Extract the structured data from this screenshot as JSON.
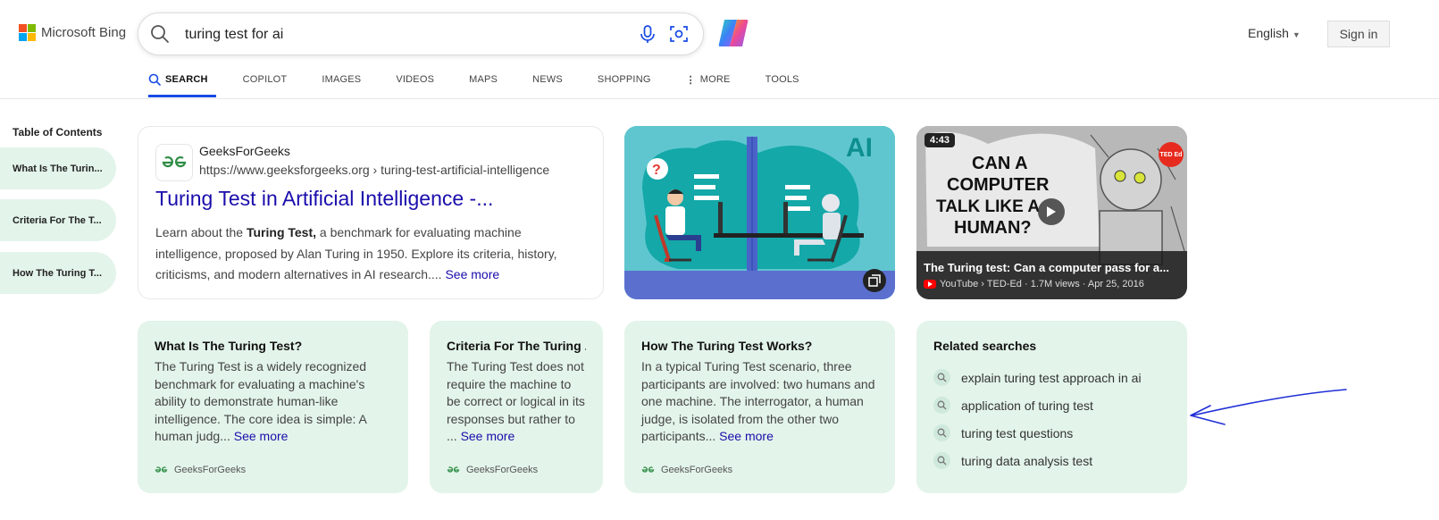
{
  "header": {
    "logo_text": "Microsoft Bing",
    "search_query": "turing test for ai",
    "language": "English",
    "sign_in": "Sign in"
  },
  "nav": {
    "tabs": [
      "SEARCH",
      "COPILOT",
      "IMAGES",
      "VIDEOS",
      "MAPS",
      "NEWS",
      "SHOPPING",
      "MORE",
      "TOOLS"
    ],
    "active": "SEARCH"
  },
  "toc": {
    "title": "Table of Contents",
    "items": [
      "What Is The Turin...",
      "Criteria For The T...",
      "How The Turing T..."
    ]
  },
  "result": {
    "site_name": "GeeksForGeeks",
    "url": "https://www.geeksforgeeks.org › turing-test-artificial-intelligence",
    "title": "Turing Test in Artificial Intelligence -...",
    "snippet_before": "Learn about the ",
    "snippet_bold": "Turing Test,",
    "snippet_after": " a benchmark for evaluating machine intelligence, proposed by Alan Turing in 1950. Explore its criteria, history, criticisms, and modern alternatives in AI research.... ",
    "see_more": "See more"
  },
  "image_tile": {
    "badge": "AI"
  },
  "video": {
    "duration": "4:43",
    "overlay_text": [
      "CAN A",
      "COMPUTER",
      "TALK LIKE A",
      "HUMAN?"
    ],
    "channel_badge": "TED Ed",
    "title": "The Turing test: Can a computer pass for a...",
    "meta": "YouTube › TED-Ed · 1.7M views · Apr 25, 2016"
  },
  "cards": [
    {
      "title": "What Is The Turing Test?",
      "body": "The Turing Test is a widely recognized benchmark for evaluating a machine's ability to demonstrate human-like intelligence. The core idea is simple: A human judg...",
      "see_more": "See more",
      "source": "GeeksForGeeks"
    },
    {
      "title": "Criteria For The Turing ...",
      "body": "The Turing Test does not require the machine to be correct or logical in its responses but rather to ...",
      "see_more": "See more",
      "source": "GeeksForGeeks"
    },
    {
      "title": "How The Turing Test Works?",
      "body": "In a typical Turing Test scenario, three participants are involved: two humans and one machine. The interrogator, a human judge, is isolated from the other two participants...",
      "see_more": "See more",
      "source": "GeeksForGeeks"
    }
  ],
  "related": {
    "title": "Related searches",
    "items": [
      "explain turing test approach in ai",
      "application of turing test",
      "turing test questions",
      "turing data analysis test"
    ]
  },
  "colors": {
    "link": "#1a0dab",
    "accent": "#174ae4",
    "card_bg": "#e3f4ea",
    "annotation": "#1f2fd6"
  }
}
